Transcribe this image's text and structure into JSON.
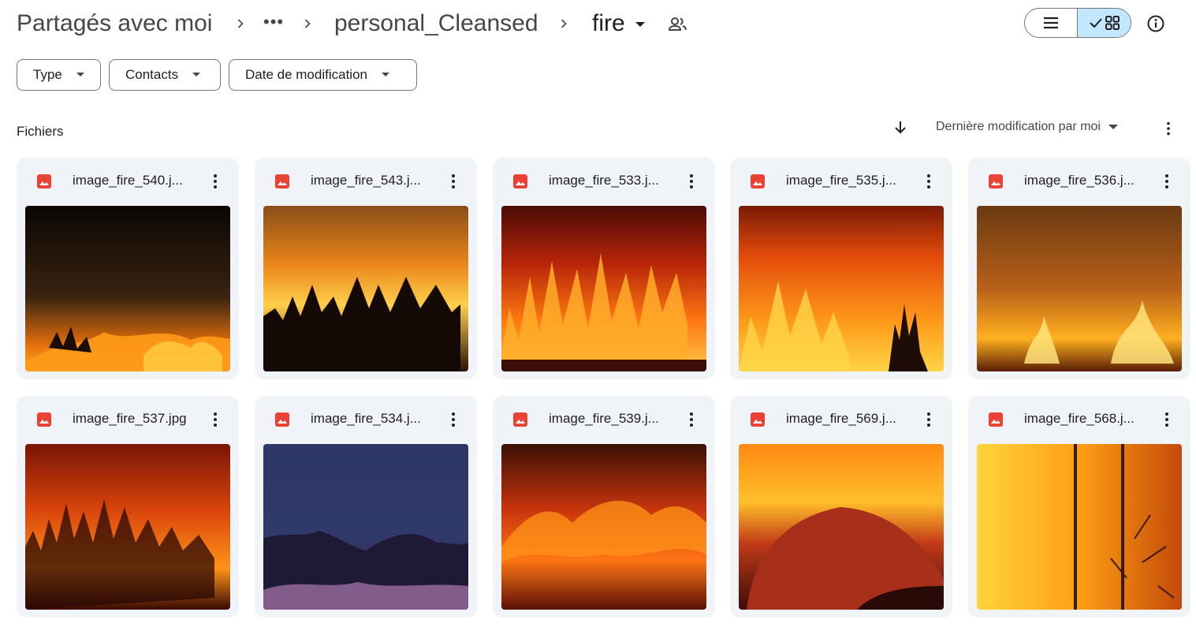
{
  "breadcrumb": {
    "root": "Partagés avec moi",
    "ellipsis": "•••",
    "folder": "personal_Cleansed",
    "current": "fire"
  },
  "icons": {
    "separator": "chevron-right-icon",
    "dropdown": "arrow-drop-down-icon",
    "shared": "people-icon",
    "list_view": "list-icon",
    "grid_view": "grid-icon",
    "check": "check-icon",
    "info": "info-icon",
    "sort": "arrow-downward-icon",
    "more": "more-vert-icon",
    "file": "image-file-icon"
  },
  "filters": [
    {
      "label": "Type"
    },
    {
      "label": "Contacts"
    },
    {
      "label": "Date de modification"
    }
  ],
  "section": {
    "title": "Fichiers",
    "sort_label": "Dernière modification par moi"
  },
  "colors": {
    "accent_selected": "#c2e7ff",
    "card_bg": "#f0f4f9",
    "file_icon_red": "#ea4335"
  },
  "files": [
    {
      "name": "image_fire_540.j..."
    },
    {
      "name": "image_fire_543.j..."
    },
    {
      "name": "image_fire_533.j..."
    },
    {
      "name": "image_fire_535.j..."
    },
    {
      "name": "image_fire_536.j..."
    },
    {
      "name": "image_fire_537.jpg"
    },
    {
      "name": "image_fire_534.j..."
    },
    {
      "name": "image_fire_539.j..."
    },
    {
      "name": "image_fire_569.j..."
    },
    {
      "name": "image_fire_568.j..."
    }
  ]
}
